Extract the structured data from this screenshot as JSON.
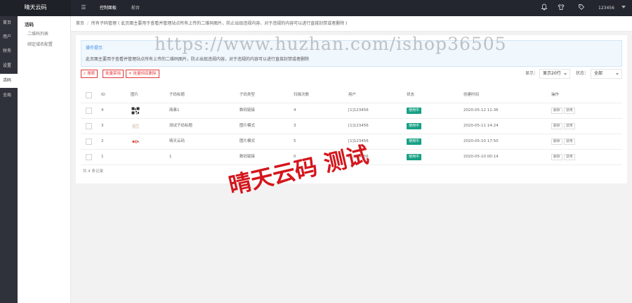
{
  "topbar": {
    "brand": "晴天云码",
    "nav": [
      "控制面板",
      "前台"
    ],
    "user": "123456",
    "icons": [
      "menu-icon",
      "bell-icon",
      "shirt-icon",
      "tag-icon"
    ]
  },
  "rail": {
    "items": [
      "首页",
      "用户",
      "财务",
      "设置",
      "活码",
      "全局"
    ],
    "active_index": 4
  },
  "subside": {
    "title": "活码",
    "links": [
      "二维码列表",
      "绑定域名配置"
    ]
  },
  "breadcrumb": {
    "home": "首页",
    "current": "所有子码管理 ( 此页面主要用于查看并管理站点所有上传的二维码图片，防止出现违规内容，对于违规的内容可以进行直接封禁或者删除 )"
  },
  "tip": {
    "title": "操作提示",
    "text": "此页面主要用于查看并管理站点所有上传的二维码图片，防止出现违规内容，对于违规的内容可以进行直接封禁或者删除"
  },
  "toolbar": {
    "search": "搜索",
    "batch_ban": "批量禁用",
    "batch_delete": "批量彻底删除",
    "display_label": "显示：",
    "display_value": "显示20行",
    "status_label": "状态：",
    "status_value": "全部"
  },
  "table": {
    "headers": [
      "ID",
      "图片",
      "子码标题",
      "子码类型",
      "扫描次数",
      "用户",
      "状态",
      "创建时间",
      "操作"
    ],
    "rows": [
      {
        "id": "4",
        "thumb": "qr",
        "title": "简素1",
        "type": "数码链接",
        "scans": "4",
        "user": "[1]123456",
        "status": "使用中",
        "created": "2020-05-12 11:36",
        "op_delete": "删除",
        "op_ban": "禁用"
      },
      {
        "id": "3",
        "thumb": "faint",
        "title": "测试子码标题",
        "type": "图片模式",
        "scans": "3",
        "user": "[1]123456",
        "status": "使用中",
        "created": "2020-05-11 14:24",
        "op_delete": "删除",
        "op_ban": "禁用"
      },
      {
        "id": "2",
        "thumb": "logo",
        "title": "晴天云码",
        "type": "图片模式",
        "scans": "5",
        "user": "[1]123456",
        "status": "使用中",
        "created": "2020-05-10 17:50",
        "op_delete": "删除",
        "op_ban": "禁用"
      },
      {
        "id": "1",
        "thumb": "none",
        "title": "1",
        "type": "数码链接",
        "scans": "0",
        "user": "[1]123456",
        "status": "使用中",
        "created": "2020-05-10 00:14",
        "op_delete": "删除",
        "op_ban": "禁用"
      }
    ],
    "total": "共 4 条记录"
  },
  "watermarks": {
    "url": "https://www.huzhan.com/ishop36505",
    "stamp": "晴天云码 测试"
  },
  "colors": {
    "topbar": "#23262e",
    "rail": "#2f323a",
    "accent_red": "#e4393c",
    "status_green": "#16a085",
    "tip_blue": "#3a8ee6"
  }
}
